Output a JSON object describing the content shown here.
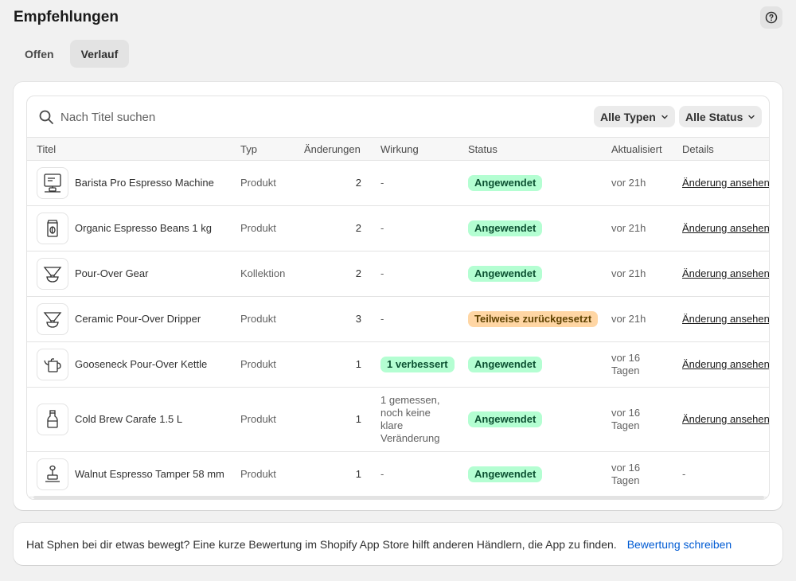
{
  "header": {
    "title": "Empfehlungen",
    "help_icon": "help-circle-icon"
  },
  "tabs": [
    {
      "label": "Offen",
      "active": false
    },
    {
      "label": "Verlauf",
      "active": true
    }
  ],
  "search": {
    "placeholder": "Nach Titel suchen",
    "value": ""
  },
  "filters": {
    "types_label": "Alle Typen",
    "status_label": "Alle Status"
  },
  "columns": {
    "title": "Titel",
    "type": "Typ",
    "changes": "Änderungen",
    "effect": "Wirkung",
    "status": "Status",
    "updated": "Aktualisiert",
    "details": "Details"
  },
  "rows": [
    {
      "title": "Barista Pro Espresso Machine",
      "type": "Produkt",
      "changes": "2",
      "effect": "-",
      "status": "Angewendet",
      "updated": "vor 21h",
      "details": "Änderung ansehen",
      "icon": "espresso-machine-icon"
    },
    {
      "title": "Organic Espresso Beans 1 kg",
      "type": "Produkt",
      "changes": "2",
      "effect": "-",
      "status": "Angewendet",
      "updated": "vor 21h",
      "details": "Änderung ansehen",
      "icon": "coffee-bag-icon"
    },
    {
      "title": "Pour-Over Gear",
      "type": "Kollektion",
      "changes": "2",
      "effect": "-",
      "status": "Angewendet",
      "updated": "vor 21h",
      "details": "Änderung ansehen",
      "icon": "dripper-icon"
    },
    {
      "title": "Ceramic Pour-Over Dripper",
      "type": "Produkt",
      "changes": "3",
      "effect": "-",
      "status": "Teilweise zurückgesetzt",
      "updated": "vor 21h",
      "details": "Änderung ansehen",
      "icon": "dripper-icon"
    },
    {
      "title": "Gooseneck Pour-Over Kettle",
      "type": "Produkt",
      "changes": "1",
      "effect": "1 verbessert",
      "status": "Angewendet",
      "updated": "vor 16 Tagen",
      "details": "Änderung ansehen",
      "icon": "kettle-icon"
    },
    {
      "title": "Cold Brew Carafe 1.5 L",
      "type": "Produkt",
      "changes": "1",
      "effect": "1 gemessen, noch keine klare Veränderung",
      "status": "Angewendet",
      "updated": "vor 16 Tagen",
      "details": "Änderung ansehen",
      "icon": "bottle-icon"
    },
    {
      "title": "Walnut Espresso Tamper 58 mm",
      "type": "Produkt",
      "changes": "1",
      "effect": "-",
      "status": "Angewendet",
      "updated": "vor 16 Tagen",
      "details": "-",
      "icon": "tamper-icon"
    }
  ],
  "footer": {
    "text": "Hat Sphen bei dir etwas bewegt? Eine kurze Bewertung im Shopify App Store hilft anderen Händlern, die App zu finden.",
    "link": "Bewertung schreiben"
  },
  "colors": {
    "success_bg": "#b4fed2",
    "success_fg": "#0c5132",
    "warning_bg": "#ffd6a4",
    "warning_fg": "#5e4200",
    "link": "#005bd3"
  }
}
